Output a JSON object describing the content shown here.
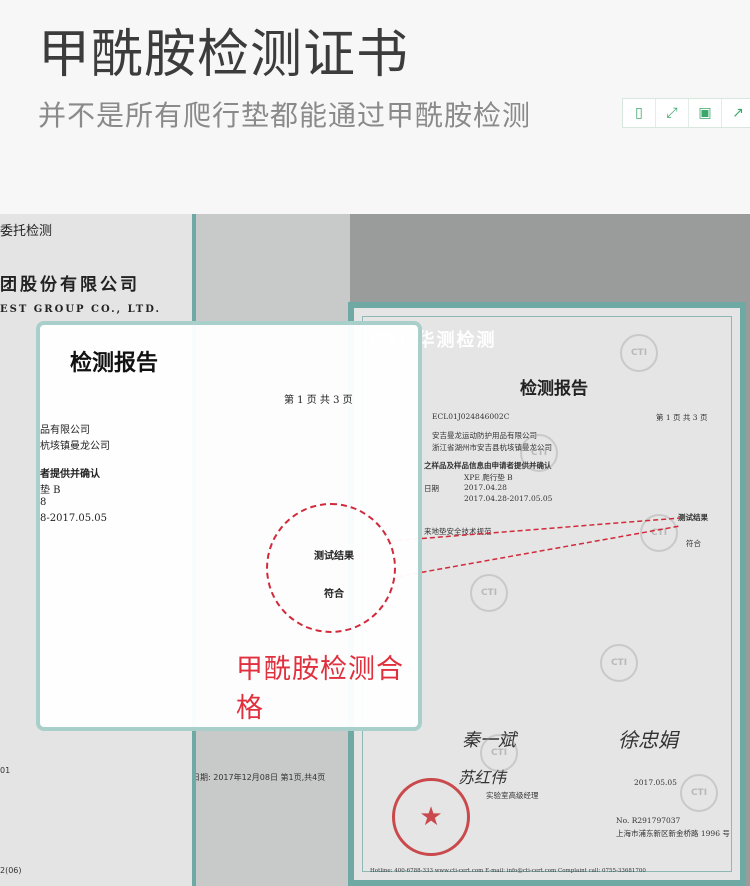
{
  "header": {
    "title": "甲酰胺检测证书",
    "subtitle": "并不是所有爬行垫都能通过甲酰胺检测",
    "toolbar": [
      {
        "icon": "tablet-icon",
        "glyph": "▯"
      },
      {
        "icon": "expand-icon",
        "glyph": "⤢"
      },
      {
        "icon": "save-icon",
        "glyph": "▣"
      },
      {
        "icon": "share-icon",
        "glyph": "↗"
      }
    ]
  },
  "left_sheet": {
    "line1": "委托检测",
    "line2": "团股份有限公司",
    "line3": "EST  GROUP  CO.,  LTD.",
    "footer1": "01",
    "footer2": "2(06)"
  },
  "mid_sheet": {
    "footer": "日期: 2017年12月08日    第1页,共4页"
  },
  "certificate": {
    "brand": "CTI 华测检测",
    "heading": "检测报告",
    "report_no": "ECL01J024846002C",
    "page": "第 1 页  共 3 页",
    "client": "安吉曼龙运动防护用品有限公司",
    "address": "浙江省湖州市安吉县杭垓镇曼龙公司",
    "section": "之样品及样品信息由申请者提供并确认",
    "sample": "XPE 爬行垫 B",
    "date_label": "日期",
    "date1": "2017.04.28",
    "period": "2017.04.28-2017.05.05",
    "standard": "来地垫安全技术规范",
    "result_label": "测试结果",
    "result_value": "符合",
    "signer1": "秦一斌",
    "signer2": "徐忠娟",
    "signer3": "苏红伟",
    "signer3_title": "实验室高级经理",
    "sign_date": "2017.05.05",
    "cert_no": "No. R291797037",
    "address_footer": "上海市浦东新区新金桥路 1996 号",
    "footer": "Hotline: 400-6788-333    www.cti-cert.com    E-mail: info@cti-cert.com    Complaint call: 0755-33681700"
  },
  "zoom_panel": {
    "heading": "检测报告",
    "page": "第 1 页   共 3 页",
    "client_partial": "品有限公司",
    "address_partial": "杭垓镇曼龙公司",
    "section_partial": "者提供并确认",
    "sample_partial": "垫 B",
    "date_partial": "8",
    "period_partial": "8-2017.05.05",
    "result_label": "测试结果",
    "result_value": "符合"
  },
  "callout": "甲酰胺检测合格",
  "watermark": "CTI",
  "colors": {
    "accent_green": "#3aa86a",
    "frame_teal": "#6ea9a4",
    "highlight_red": "#e0303e"
  }
}
